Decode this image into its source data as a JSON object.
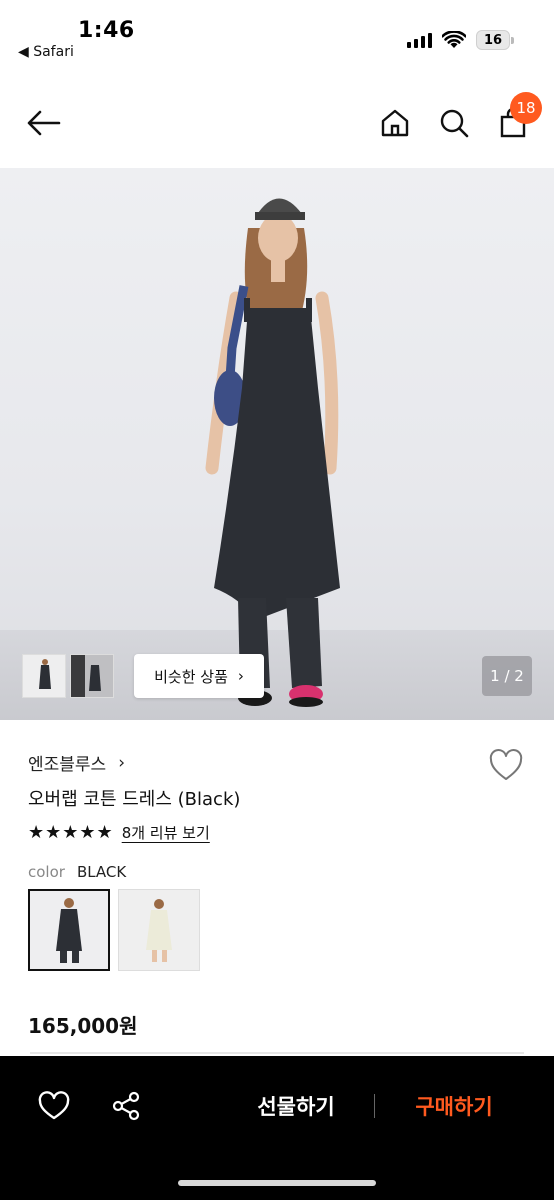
{
  "status_bar": {
    "time": "1:46",
    "back_app": "◀ Safari",
    "battery": "16"
  },
  "nav": {
    "cart_count": "18"
  },
  "gallery": {
    "similar_label": "비슷한 상품",
    "similar_chevron": "›",
    "page_counter": "1 / 2"
  },
  "product": {
    "brand": "엔조블루스",
    "brand_chevron": "›",
    "name": "오버랩 코튼 드레스 (Black)",
    "stars": "★★★★★",
    "review_link": "8개 리뷰 보기",
    "color_label": "color",
    "color_value": "BLACK",
    "price": "165,000원"
  },
  "bottom_bar": {
    "gift_label": "선물하기",
    "buy_label": "구매하기"
  },
  "colors": {
    "accent": "#ff5a1f",
    "bottom_bar_bg": "#000000"
  }
}
